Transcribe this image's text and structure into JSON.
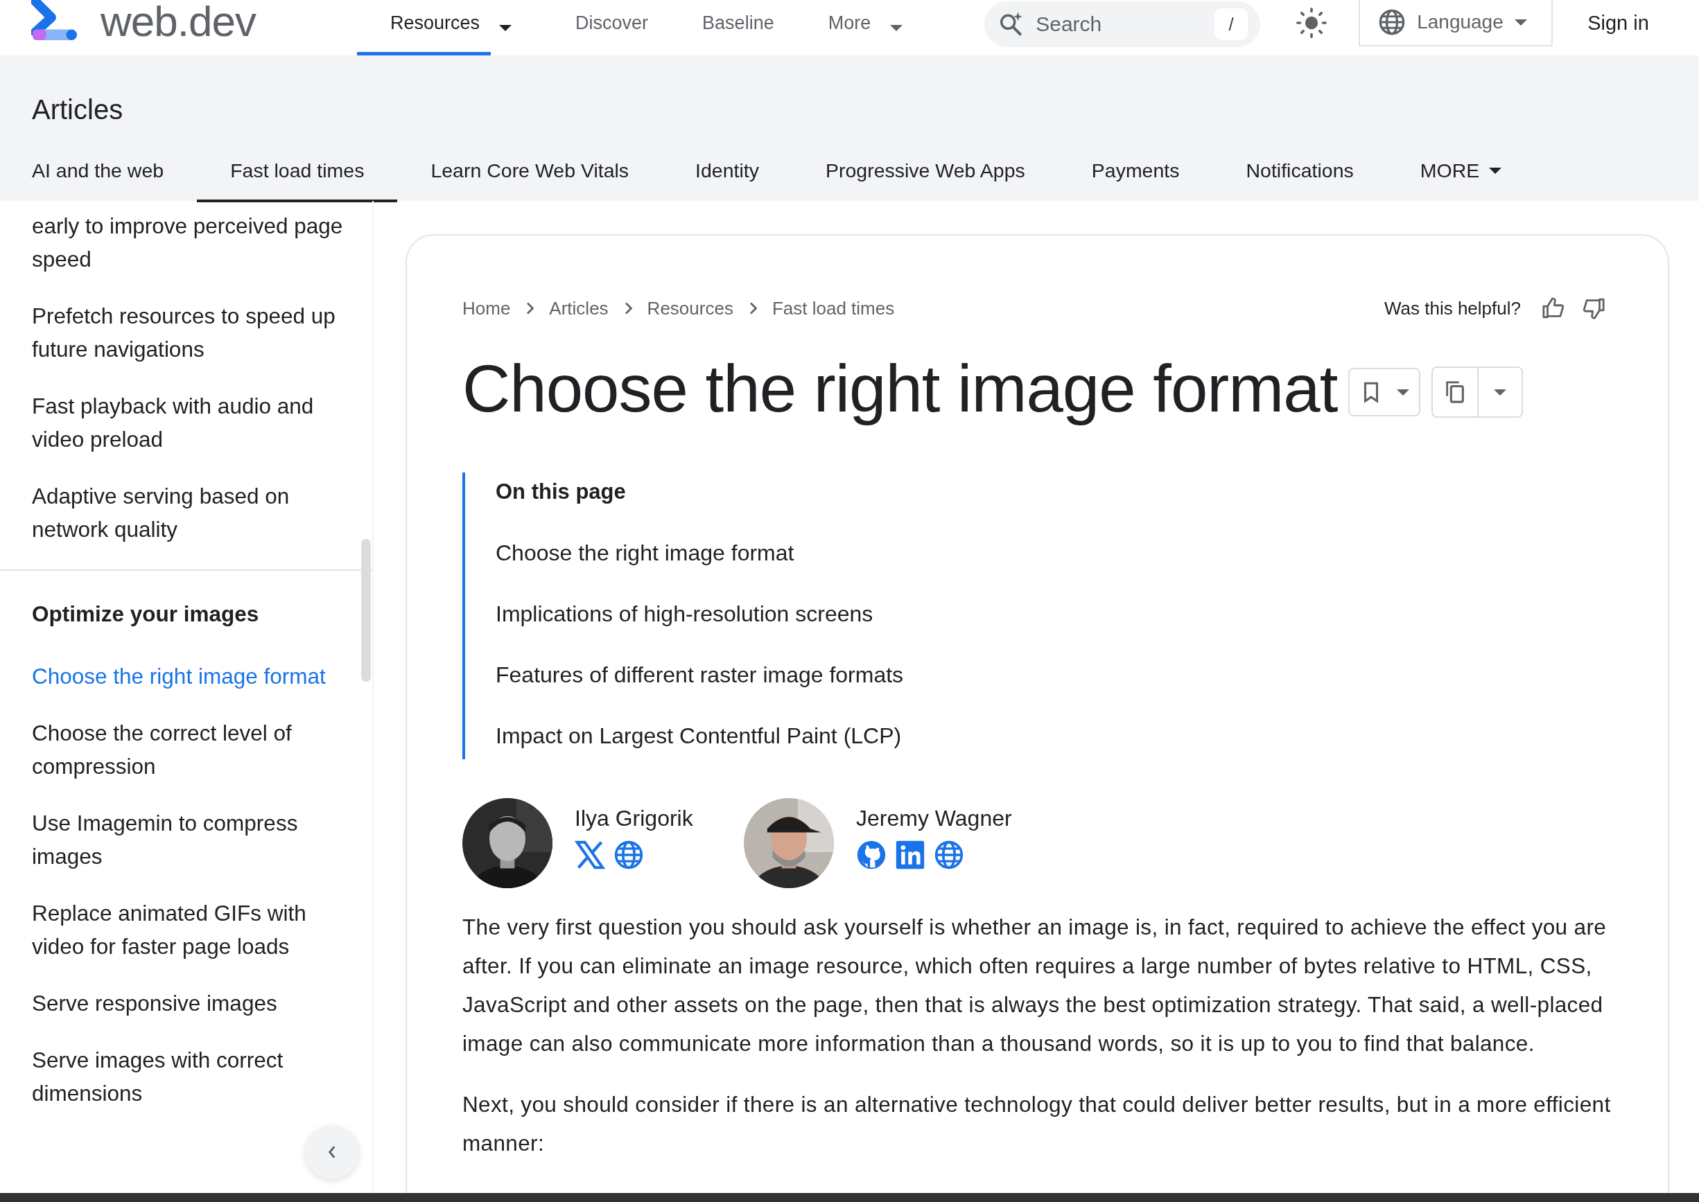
{
  "top_nav": {
    "logo_text": "web.dev",
    "items": [
      {
        "label": "Resources",
        "selected": true,
        "dropdown": true
      },
      {
        "label": "Discover",
        "selected": false,
        "dropdown": false
      },
      {
        "label": "Baseline",
        "selected": false,
        "dropdown": false
      },
      {
        "label": "More",
        "selected": false,
        "dropdown": true
      }
    ],
    "search": {
      "placeholder": "Search",
      "shortcut": "/"
    },
    "language": "Language",
    "sign_in": "Sign in"
  },
  "section": {
    "title": "Articles",
    "tabs": [
      {
        "label": "AI and the web",
        "selected": false,
        "dropdown": false
      },
      {
        "label": "Fast load times",
        "selected": true,
        "dropdown": false
      },
      {
        "label": "Learn Core Web Vitals",
        "selected": false,
        "dropdown": false
      },
      {
        "label": "Identity",
        "selected": false,
        "dropdown": false
      },
      {
        "label": "Progressive Web Apps",
        "selected": false,
        "dropdown": false
      },
      {
        "label": "Payments",
        "selected": false,
        "dropdown": false
      },
      {
        "label": "Notifications",
        "selected": false,
        "dropdown": false
      },
      {
        "label": "MORE",
        "selected": false,
        "dropdown": true
      }
    ]
  },
  "sidebar": {
    "sections": [
      {
        "items": [
          {
            "label": "early to improve perceived page speed",
            "selected": false
          },
          {
            "label": "Prefetch resources to speed up future navigations",
            "selected": false
          },
          {
            "label": "Fast playback with audio and video preload",
            "selected": false
          },
          {
            "label": "Adaptive serving based on network quality",
            "selected": false
          }
        ]
      },
      {
        "heading": "Optimize your images",
        "items": [
          {
            "label": "Choose the right image format",
            "selected": true
          },
          {
            "label": "Choose the correct level of compression",
            "selected": false
          },
          {
            "label": "Use Imagemin to compress images",
            "selected": false
          },
          {
            "label": "Replace animated GIFs with video for faster page loads",
            "selected": false
          },
          {
            "label": "Serve responsive images",
            "selected": false
          },
          {
            "label": "Serve images with correct dimensions",
            "selected": false
          }
        ]
      }
    ]
  },
  "article": {
    "breadcrumbs": [
      "Home",
      "Articles",
      "Resources",
      "Fast load times"
    ],
    "feedback": "Was this helpful?",
    "title": "Choose the right image format",
    "toc": {
      "heading": "On this page",
      "items": [
        "Choose the right image format",
        "Implications of high-resolution screens",
        "Features of different raster image formats",
        "Impact on Largest Contentful Paint (LCP)"
      ]
    },
    "authors": [
      {
        "name": "Ilya Grigorik",
        "links": [
          {
            "kind": "x"
          },
          {
            "kind": "website"
          }
        ]
      },
      {
        "name": "Jeremy Wagner",
        "links": [
          {
            "kind": "github"
          },
          {
            "kind": "linkedin"
          },
          {
            "kind": "website"
          }
        ]
      }
    ],
    "paragraphs": [
      "The very first question you should ask yourself is whether an image is, in fact, required to achieve the effect you are after. If you can eliminate an image resource, which often requires a large number of bytes relative to HTML, CSS, JavaScript and other assets on the page, then that is always the best optimization strategy. That said, a well-placed image can also communicate more information than a thousand words, so it is up to you to find that balance.",
      "Next, you should consider if there is an alternative technology that could deliver better results, but in a more efficient manner:"
    ]
  }
}
